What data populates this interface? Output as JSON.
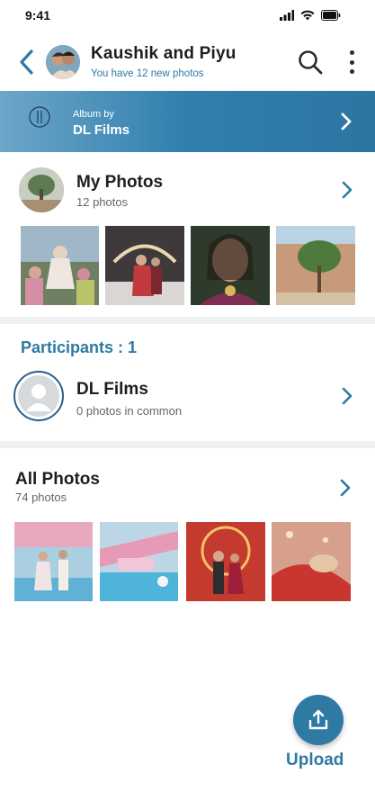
{
  "status_bar": {
    "time": "9:41",
    "icons": [
      "signal-icon",
      "wifi-icon",
      "battery-icon"
    ]
  },
  "header": {
    "title": "Kaushik and Piyu",
    "subtitle": "You have 12 new photos",
    "back_icon": "back-chevron-icon",
    "search_icon": "search-icon",
    "more_icon": "more-vertical-icon"
  },
  "album_banner": {
    "label": "Album by",
    "name": "DL Films",
    "logo_text": "DL FILMS",
    "chevron_icon": "chevron-right-icon"
  },
  "my_photos": {
    "title": "My Photos",
    "count": "12 photos",
    "thumbnails": [
      "wedding-group-photo",
      "couple-stage-photo",
      "bride-portrait-photo",
      "tree-building-photo"
    ]
  },
  "participants": {
    "header": "Participants : 1",
    "items": [
      {
        "name": "DL Films",
        "common": "0 photos in common"
      }
    ]
  },
  "all_photos": {
    "title": "All Photos",
    "count": "74 photos",
    "thumbnails": [
      "poolside-couple-photo",
      "pool-decor-photo",
      "couple-entry-photo",
      "bride-closeup-photo"
    ]
  },
  "upload": {
    "label": "Upload",
    "icon": "upload-icon"
  },
  "colors": {
    "accent": "#2e7aa3",
    "banner_start": "#6da6c8",
    "banner_end": "#2c75a3",
    "divider": "#eef0f2"
  }
}
